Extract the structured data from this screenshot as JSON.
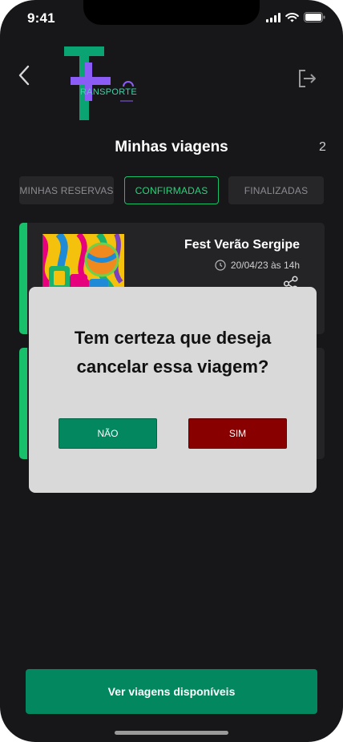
{
  "status_bar": {
    "time": "9:41"
  },
  "logo": {
    "text": "RANSPORTE"
  },
  "header": {
    "title": "Minhas viagens",
    "count": "2"
  },
  "tabs": [
    {
      "label": "MINHAS RESERVAS",
      "active": false
    },
    {
      "label": "CONFIRMADAS",
      "active": true
    },
    {
      "label": "FINALIZADAS",
      "active": false
    }
  ],
  "trips": [
    {
      "title": "Fest Verão Sergipe",
      "date": "20/04/23 às 14h"
    }
  ],
  "dialog": {
    "message_line1": "Tem certeza que deseja",
    "message_line2": "cancelar essa viagem?",
    "no_label": "NÃO",
    "yes_label": "SIM"
  },
  "footer": {
    "cta_label": "Ver viagens disponíveis"
  },
  "colors": {
    "background": "#171719",
    "accent_green": "#19c06b",
    "primary_button": "#03875f",
    "danger_button": "#880000",
    "dialog_bg": "#d9d9d9",
    "logo_green": "#0aa472",
    "logo_purple": "#8b5cf6"
  },
  "icons": [
    "back-chevron-icon",
    "logout-icon",
    "clock-icon",
    "share-icon",
    "signal-icon",
    "wifi-icon",
    "battery-icon"
  ]
}
